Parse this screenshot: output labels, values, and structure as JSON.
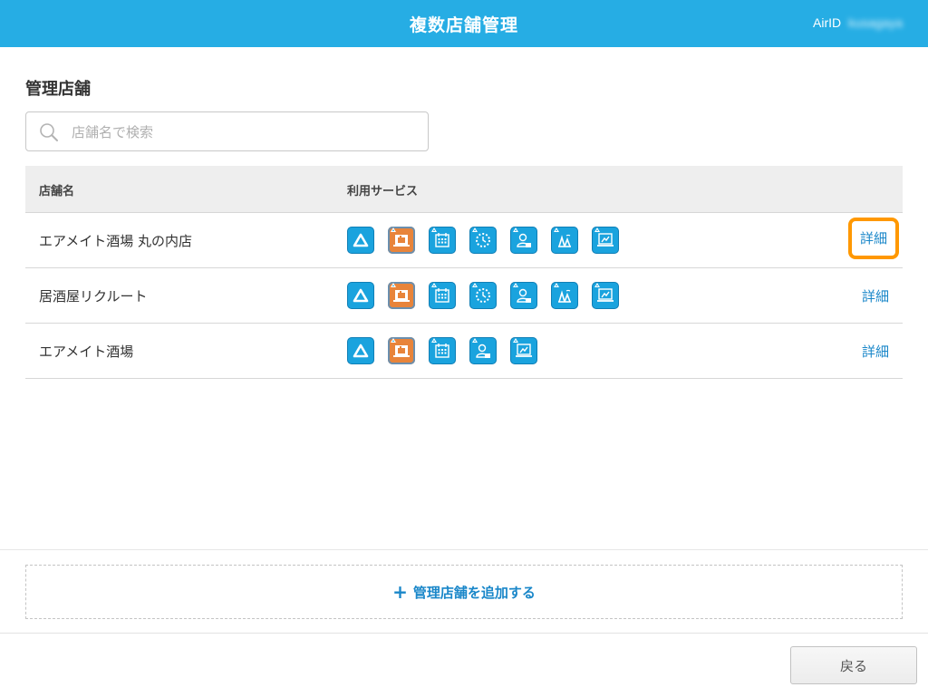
{
  "header": {
    "title": "複数店舗管理",
    "airid_label": "AirID",
    "username": "kusagaya"
  },
  "section": {
    "title": "管理店舗"
  },
  "search": {
    "placeholder": "店舗名で検索",
    "value": ""
  },
  "table": {
    "headers": {
      "store_name": "店舗名",
      "services": "利用サービス"
    },
    "rows": [
      {
        "name": "エアメイト酒場 丸の内店",
        "detail": "詳細",
        "services": [
          "airregi-icon",
          "airpay-icon",
          "airreserve-icon",
          "airshift-icon",
          "airrecruit-icon",
          "airwait-icon",
          "airmate-icon"
        ]
      },
      {
        "name": "居酒屋リクルート",
        "detail": "詳細",
        "services": [
          "airregi-icon",
          "airpay-icon",
          "airreserve-icon",
          "airshift-icon",
          "airrecruit-icon",
          "airwait-icon",
          "airmate-icon"
        ]
      },
      {
        "name": "エアメイト酒場",
        "detail": "詳細",
        "services": [
          "airregi-icon",
          "airpay-icon",
          "airreserve-icon",
          "airrecruit-icon",
          "airmate-icon"
        ]
      }
    ]
  },
  "add_store": {
    "plus": "+",
    "label": "管理店舗を追加する"
  },
  "footer": {
    "back_label": "戻る"
  },
  "colors": {
    "header": "#26ade4",
    "link": "#1a87c9",
    "highlight": "#ff9800",
    "service_icon": "#1aa3de",
    "service_icon_alt": "#e8843a"
  }
}
